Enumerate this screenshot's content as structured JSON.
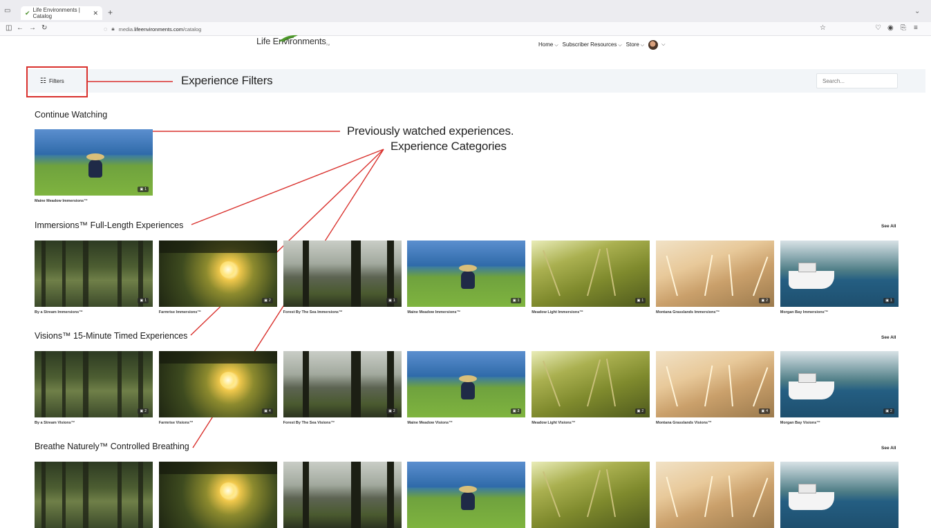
{
  "browser": {
    "tab_title": "Life Environments | Catalog",
    "url_prefix": "media.",
    "url_domain": "lifeenvironments.com",
    "url_path": "/catalog"
  },
  "header": {
    "logo_text": "Life Environments",
    "nav": [
      {
        "label": "Home"
      },
      {
        "label": "Subscriber Resources"
      },
      {
        "label": "Store"
      }
    ]
  },
  "toolbar": {
    "filters_label": "Filters",
    "search_placeholder": "Search..."
  },
  "annotations": {
    "filters": "Experience Filters",
    "previous": "Previously watched experiences.",
    "categories": "Experience Categories"
  },
  "continue_watching": {
    "title": "Continue Watching",
    "items": [
      {
        "caption": "Maine Meadow Immersions™",
        "badge": "1",
        "art": "meadow"
      }
    ]
  },
  "sections": [
    {
      "title": "Immersions™ Full-Length Experiences",
      "see_all": "See All",
      "items": [
        {
          "caption": "By a Stream Immersions™",
          "badge": "1",
          "art": "stream"
        },
        {
          "caption": "Farmrise Immersions™",
          "badge": "2",
          "art": "farm"
        },
        {
          "caption": "Forest By The Sea Immersions™",
          "badge": "1",
          "art": "forest"
        },
        {
          "caption": "Maine Meadow Immersions™",
          "badge": "1",
          "art": "meadow"
        },
        {
          "caption": "Meadow Light Immersions™",
          "badge": "1",
          "art": "light"
        },
        {
          "caption": "Montana Grasslands Immersions™",
          "badge": "2",
          "art": "montana"
        },
        {
          "caption": "Morgan Bay Immersions™",
          "badge": "1",
          "art": "bay"
        }
      ]
    },
    {
      "title": "Visions™ 15-Minute Timed Experiences",
      "see_all": "See All",
      "items": [
        {
          "caption": "By a Stream Visions™",
          "badge": "2",
          "art": "stream"
        },
        {
          "caption": "Farmrise Visions™",
          "badge": "4",
          "art": "farm"
        },
        {
          "caption": "Forest By The Sea Visions™",
          "badge": "2",
          "art": "forest"
        },
        {
          "caption": "Maine Meadow Visions™",
          "badge": "2",
          "art": "meadow"
        },
        {
          "caption": "Meadow Light Visions™",
          "badge": "2",
          "art": "light"
        },
        {
          "caption": "Montana Grasslands Visions™",
          "badge": "4",
          "art": "montana"
        },
        {
          "caption": "Morgan Bay Visions™",
          "badge": "2",
          "art": "bay"
        }
      ]
    },
    {
      "title": "Breathe Naturely™ Controlled Breathing",
      "see_all": "See All",
      "items": [
        {
          "caption": "",
          "badge": "",
          "art": "stream"
        },
        {
          "caption": "",
          "badge": "",
          "art": "farm"
        },
        {
          "caption": "",
          "badge": "",
          "art": "forest"
        },
        {
          "caption": "",
          "badge": "",
          "art": "meadow"
        },
        {
          "caption": "",
          "badge": "",
          "art": "light"
        },
        {
          "caption": "",
          "badge": "",
          "art": "montana"
        },
        {
          "caption": "",
          "badge": "",
          "art": "bay"
        }
      ]
    }
  ],
  "colors": {
    "annotation_red": "#d9302c",
    "filter_bar": "#f2f5f8"
  }
}
